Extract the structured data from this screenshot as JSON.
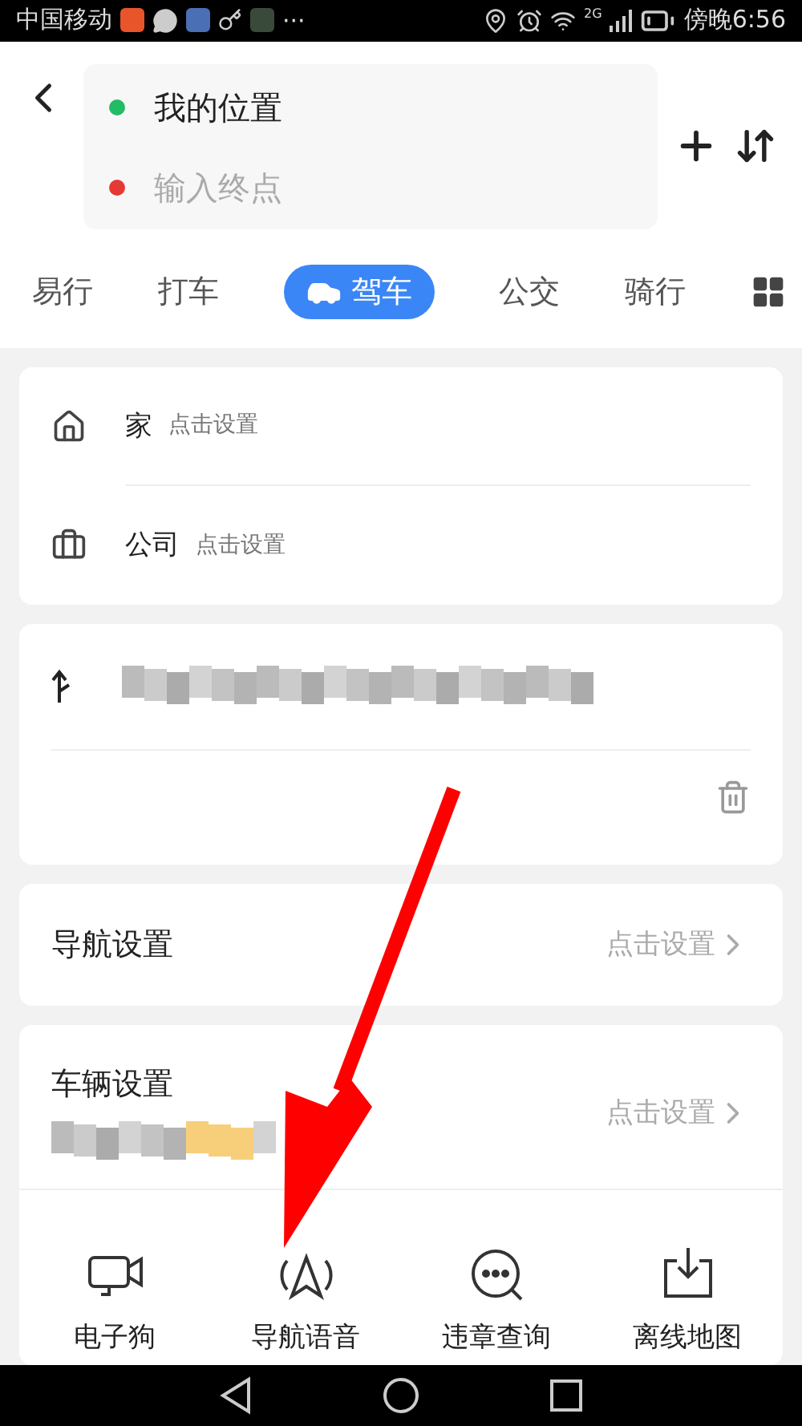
{
  "status_bar": {
    "carrier": "中国移动",
    "more": "···",
    "network": "2G",
    "time": "傍晚6:56"
  },
  "route": {
    "origin": "我的位置",
    "destination_placeholder": "输入终点"
  },
  "modes": [
    {
      "label": "易行",
      "selected": false
    },
    {
      "label": "打车",
      "selected": false
    },
    {
      "label": "驾车",
      "selected": true
    },
    {
      "label": "公交",
      "selected": false
    },
    {
      "label": "骑行",
      "selected": false
    }
  ],
  "places": [
    {
      "kind": "home",
      "name": "家",
      "hint": "点击设置"
    },
    {
      "kind": "work",
      "name": "公司",
      "hint": "点击设置"
    }
  ],
  "settings": [
    {
      "title": "导航设置",
      "action": "点击设置"
    },
    {
      "title": "车辆设置",
      "action": "点击设置"
    }
  ],
  "tools": [
    {
      "kind": "camera",
      "label": "电子狗"
    },
    {
      "kind": "voice",
      "label": "导航语音"
    },
    {
      "kind": "chat",
      "label": "违章查询"
    },
    {
      "kind": "download",
      "label": "离线地图"
    }
  ]
}
